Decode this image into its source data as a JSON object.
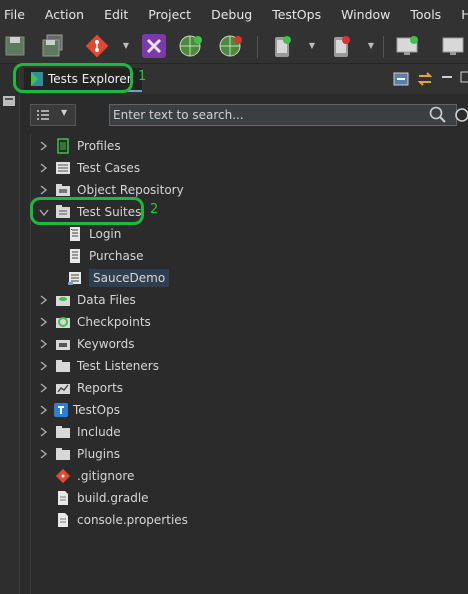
{
  "menu": [
    "File",
    "Action",
    "Edit",
    "Project",
    "Debug",
    "TestOps",
    "Window",
    "Tools",
    "Help"
  ],
  "toolbar": {
    "icons": [
      "save-icon",
      "save-all-icon",
      "git-icon",
      "katalon-recorder-icon",
      "spy-web-icon",
      "record-web-icon",
      "spy-mobile-icon",
      "record-mobile-icon",
      "spy-windows-icon",
      "record-windows-icon"
    ]
  },
  "view": {
    "tab_label": "Tests Explorer",
    "annotation_1": "1",
    "annotation_2": "2"
  },
  "search": {
    "placeholder": "Enter text to search..."
  },
  "tree": [
    {
      "label": "Profiles",
      "icon": "profiles-icon",
      "expandable": true,
      "expanded": false
    },
    {
      "label": "Test Cases",
      "icon": "test-cases-icon",
      "expandable": true,
      "expanded": false
    },
    {
      "label": "Object Repository",
      "icon": "object-repository-icon",
      "expandable": true,
      "expanded": false
    },
    {
      "label": "Test Suites",
      "icon": "test-suites-icon",
      "expandable": true,
      "expanded": true
    },
    {
      "label": "Login",
      "icon": "test-suite-icon",
      "expandable": false,
      "child": true
    },
    {
      "label": "Purchase",
      "icon": "test-suite-icon",
      "expandable": false,
      "child": true
    },
    {
      "label": "SauceDemo",
      "icon": "test-suite-collection-icon",
      "expandable": false,
      "child": true,
      "selected": true
    },
    {
      "label": "Data Files",
      "icon": "data-files-icon",
      "expandable": true,
      "expanded": false
    },
    {
      "label": "Checkpoints",
      "icon": "checkpoints-icon",
      "expandable": true,
      "expanded": false
    },
    {
      "label": "Keywords",
      "icon": "keywords-icon",
      "expandable": true,
      "expanded": false
    },
    {
      "label": "Test Listeners",
      "icon": "folder-icon",
      "expandable": true,
      "expanded": false
    },
    {
      "label": "Reports",
      "icon": "reports-icon",
      "expandable": true,
      "expanded": false
    },
    {
      "label": "TestOps",
      "icon": "testops-icon",
      "expandable": true,
      "expanded": false
    },
    {
      "label": "Include",
      "icon": "folder-icon",
      "expandable": true,
      "expanded": false
    },
    {
      "label": "Plugins",
      "icon": "folder-icon",
      "expandable": true,
      "expanded": false
    },
    {
      "label": ".gitignore",
      "icon": "git-file-icon",
      "expandable": false
    },
    {
      "label": "build.gradle",
      "icon": "file-icon",
      "expandable": false
    },
    {
      "label": "console.properties",
      "icon": "file-icon",
      "expandable": false
    }
  ],
  "colors": {
    "annotation": "#1fb83f",
    "selection": "#2f3f4f",
    "background": "#2b2b2b"
  }
}
